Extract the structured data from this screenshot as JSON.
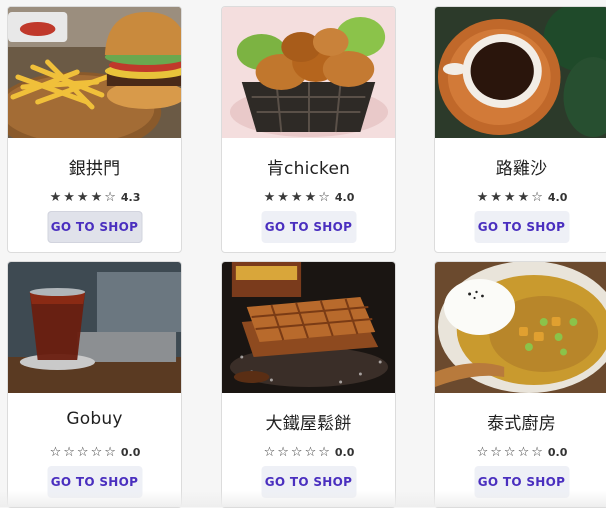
{
  "button_label": "GO TO SHOP",
  "stores": [
    {
      "name": "銀拱門",
      "rating": 4.3,
      "rating_text": "4.3",
      "stars": [
        "★",
        "★",
        "★",
        "★",
        "☆"
      ]
    },
    {
      "name": "肯chicken",
      "rating": 4.0,
      "rating_text": "4.0",
      "stars": [
        "★",
        "★",
        "★",
        "★",
        "☆"
      ]
    },
    {
      "name": "路雞沙",
      "rating": 4.0,
      "rating_text": "4.0",
      "stars": [
        "★",
        "★",
        "★",
        "★",
        "☆"
      ]
    },
    {
      "name": "Gobuy",
      "rating": 0.0,
      "rating_text": "0.0",
      "stars": [
        "☆",
        "☆",
        "☆",
        "☆",
        "☆"
      ]
    },
    {
      "name": "大鐵屋鬆餅",
      "rating": 0.0,
      "rating_text": "0.0",
      "stars": [
        "☆",
        "☆",
        "☆",
        "☆",
        "☆"
      ]
    },
    {
      "name": "泰式廚房",
      "rating": 0.0,
      "rating_text": "0.0",
      "stars": [
        "☆",
        "☆",
        "☆",
        "☆",
        "☆"
      ]
    }
  ],
  "colors": {
    "button_text": "#4a2fbf",
    "button_bg": "#eef0f6",
    "star": "#3a3a3a"
  }
}
